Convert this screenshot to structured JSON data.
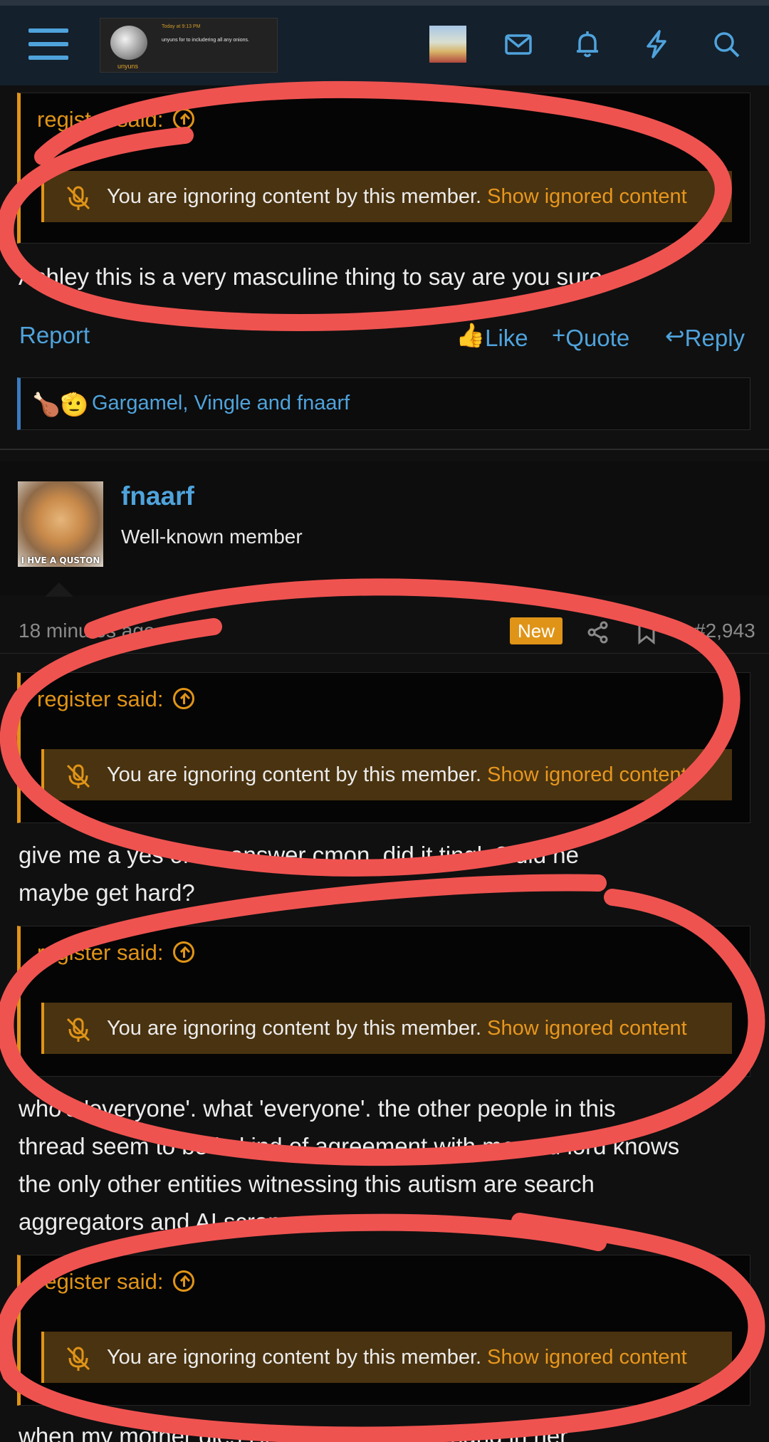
{
  "header": {
    "banner_name": "unyuns",
    "banner_time": "Today at 9:13 PM",
    "banner_line": "unyuns for to includering all any onions."
  },
  "post1": {
    "quote_author": "register said:",
    "ignore_message": "You are ignoring content by this member.",
    "ignore_link": "Show ignored content",
    "body": "Ashley this is a very masculine thing to say are you sure.",
    "actions": {
      "report": "Report",
      "like": "Like",
      "quote": "Quote",
      "reply": "Reply"
    },
    "reactions": {
      "emoji": "🍗🫡",
      "users": "Gargamel, Vingle and fnaarf"
    }
  },
  "post2": {
    "username": "fnaarf",
    "user_title": "Well-known member",
    "avatar_caption": "I HVE A QUSTON",
    "time_ago": "18 minutes ago",
    "new_badge": "New",
    "post_number": "#2,943",
    "quotes": [
      {
        "author": "register said:",
        "ignore_message": "You are ignoring content by this member.",
        "ignore_link": "Show ignored content"
      },
      {
        "author": "register said:",
        "ignore_message": "You are ignoring content by this member.",
        "ignore_link": "Show ignored content"
      },
      {
        "author": "register said:",
        "ignore_message": "You are ignoring content by this member.",
        "ignore_link": "Show ignored content"
      }
    ],
    "body1_line1": "give me a yes or no answer cmon. did it tingle? did he",
    "body1_line2": "maybe get hard?",
    "body2_line1": "who's 'everyone'. what 'everyone'. the other people in this",
    "body2_line2": "thread seem to be in kind of agreement with me and lord knows",
    "body2_line3": "the only other entities witnessing this autism are search",
    "body2_line4": "aggregators and AI scrapers",
    "body3_line1": "when my mother dies I'll have a personal hand in her"
  },
  "colors": {
    "accent_orange": "#e09417",
    "link_blue": "#4fa3dc",
    "scribble_red": "#ef5350"
  }
}
